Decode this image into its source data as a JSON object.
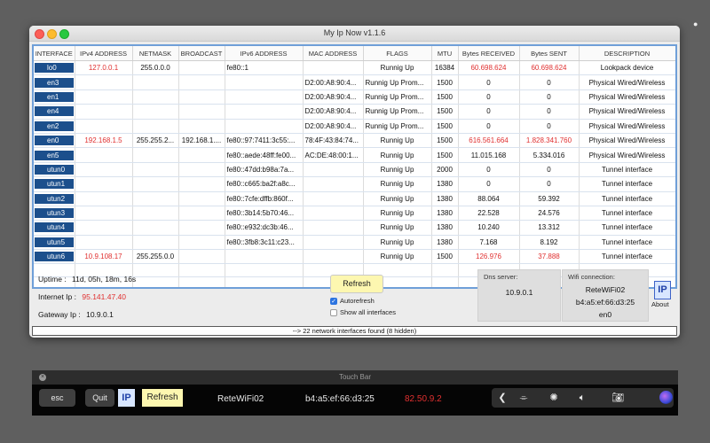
{
  "window": {
    "title": "My Ip Now  v1.1.6"
  },
  "table": {
    "headers": [
      "INTERFACE",
      "IPv4 ADDRESS",
      "NETMASK",
      "BROADCAST",
      "IPv6 ADDRESS",
      "MAC ADDRESS",
      "FLAGS",
      "MTU",
      "Bytes RECEIVED",
      "Bytes SENT",
      "DESCRIPTION"
    ],
    "rows": [
      {
        "iface": "lo0",
        "ipv4": "127.0.0.1",
        "netmask": "255.0.0.0",
        "broadcast": "",
        "ipv6": "fe80::1",
        "mac": "",
        "flags": "Runnig Up",
        "mtu": "16384",
        "rx": "60.698.624",
        "tx": "60.698.624",
        "desc": "Lookpack device",
        "highlight": true
      },
      {
        "iface": "en3",
        "ipv4": "",
        "netmask": "",
        "broadcast": "",
        "ipv6": "",
        "mac": "D2:00:A8:90:4...",
        "flags": "Runnig Up Prom...",
        "mtu": "1500",
        "rx": "0",
        "tx": "0",
        "desc": "Physical Wired/Wireless",
        "highlight": false
      },
      {
        "iface": "en1",
        "ipv4": "",
        "netmask": "",
        "broadcast": "",
        "ipv6": "",
        "mac": "D2:00:A8:90:4...",
        "flags": "Runnig Up Prom...",
        "mtu": "1500",
        "rx": "0",
        "tx": "0",
        "desc": "Physical Wired/Wireless",
        "highlight": false
      },
      {
        "iface": "en4",
        "ipv4": "",
        "netmask": "",
        "broadcast": "",
        "ipv6": "",
        "mac": "D2:00:A8:90:4...",
        "flags": "Runnig Up Prom...",
        "mtu": "1500",
        "rx": "0",
        "tx": "0",
        "desc": "Physical Wired/Wireless",
        "highlight": false
      },
      {
        "iface": "en2",
        "ipv4": "",
        "netmask": "",
        "broadcast": "",
        "ipv6": "",
        "mac": "D2:00:A8:90:4...",
        "flags": "Runnig Up Prom...",
        "mtu": "1500",
        "rx": "0",
        "tx": "0",
        "desc": "Physical Wired/Wireless",
        "highlight": false
      },
      {
        "iface": "en0",
        "ipv4": "192.168.1.5",
        "netmask": "255.255.2...",
        "broadcast": "192.168.1....",
        "ipv6": "fe80::97:7411:3c55:...",
        "mac": "78:4F:43:84:74...",
        "flags": "Runnig Up",
        "mtu": "1500",
        "rx": "616.561.664",
        "tx": "1.828.341.760",
        "desc": "Physical Wired/Wireless",
        "highlight": true
      },
      {
        "iface": "en5",
        "ipv4": "",
        "netmask": "",
        "broadcast": "",
        "ipv6": "fe80::aede:48ff:fe00...",
        "mac": "AC:DE:48:00:1...",
        "flags": "Runnig Up",
        "mtu": "1500",
        "rx": "11.015.168",
        "tx": "5.334.016",
        "desc": "Physical Wired/Wireless",
        "highlight": false
      },
      {
        "iface": "utun0",
        "ipv4": "",
        "netmask": "",
        "broadcast": "",
        "ipv6": "fe80::47dd:b98a:7a...",
        "mac": "",
        "flags": "Runnig Up",
        "mtu": "2000",
        "rx": "0",
        "tx": "0",
        "desc": "Tunnel interface",
        "highlight": false
      },
      {
        "iface": "utun1",
        "ipv4": "",
        "netmask": "",
        "broadcast": "",
        "ipv6": "fe80::c665:ba2f:a8c...",
        "mac": "",
        "flags": "Runnig Up",
        "mtu": "1380",
        "rx": "0",
        "tx": "0",
        "desc": "Tunnel interface",
        "highlight": false
      },
      {
        "iface": "utun2",
        "ipv4": "",
        "netmask": "",
        "broadcast": "",
        "ipv6": "fe80::7cfe:dffb:860f...",
        "mac": "",
        "flags": "Runnig Up",
        "mtu": "1380",
        "rx": "88.064",
        "tx": "59.392",
        "desc": "Tunnel interface",
        "highlight": false
      },
      {
        "iface": "utun3",
        "ipv4": "",
        "netmask": "",
        "broadcast": "",
        "ipv6": "fe80::3b14:5b70:46...",
        "mac": "",
        "flags": "Runnig Up",
        "mtu": "1380",
        "rx": "22.528",
        "tx": "24.576",
        "desc": "Tunnel interface",
        "highlight": false
      },
      {
        "iface": "utun4",
        "ipv4": "",
        "netmask": "",
        "broadcast": "",
        "ipv6": "fe80::e932:dc3b:46...",
        "mac": "",
        "flags": "Runnig Up",
        "mtu": "1380",
        "rx": "10.240",
        "tx": "13.312",
        "desc": "Tunnel interface",
        "highlight": false
      },
      {
        "iface": "utun5",
        "ipv4": "",
        "netmask": "",
        "broadcast": "",
        "ipv6": "fe80::3fb8:3c11:c23...",
        "mac": "",
        "flags": "Runnig Up",
        "mtu": "1380",
        "rx": "7.168",
        "tx": "8.192",
        "desc": "Tunnel interface",
        "highlight": false
      },
      {
        "iface": "utun6",
        "ipv4": "10.9.108.17",
        "netmask": "255.255.0.0",
        "broadcast": "",
        "ipv6": "",
        "mac": "",
        "flags": "Runnig Up",
        "mtu": "1500",
        "rx": "126.976",
        "tx": "37.888",
        "desc": "Tunnel interface",
        "highlight": true
      }
    ]
  },
  "info": {
    "uptime_label": "Uptime :",
    "uptime_value": "11d, 05h, 18m, 16s",
    "internet_label": "Internet Ip :",
    "internet_value": "95.141.47.40",
    "gateway_label": "Gateway Ip :",
    "gateway_value": "10.9.0.1"
  },
  "controls": {
    "refresh_label": "Refresh",
    "autorefresh_label": "Autorefresh",
    "autorefresh_checked": true,
    "show_all_label": "Show all interfaces",
    "show_all_checked": false
  },
  "dns": {
    "caption": "Dns server:",
    "value": "10.9.0.1"
  },
  "wifi": {
    "caption": "Wifi connection:",
    "ssid": "ReteWiFi02",
    "bssid": "b4:a5:ef:66:d3:25",
    "iface": "en0"
  },
  "about": {
    "logo": "IP",
    "label": "About"
  },
  "status": {
    "text": "--> 22 network interfaces found (8 hidden)"
  },
  "touchbar": {
    "title": "Touch Bar",
    "esc": "esc",
    "quit": "Quit",
    "logo": "IP",
    "refresh": "Refresh",
    "ssid": "ReteWiFi02",
    "bssid": "b4:a5:ef:66:d3:25",
    "ip": "82.50.9.2",
    "ip_color": "#e03030",
    "controls": [
      "chevron-left-icon",
      "touch-id-icon",
      "brightness-icon",
      "volume-icon",
      "screenshot-icon",
      "siri-icon"
    ]
  },
  "colors": {
    "accent": "#1c4f8c",
    "highlight_text": "#e03030",
    "button_yellow": "#fdf7b0"
  }
}
